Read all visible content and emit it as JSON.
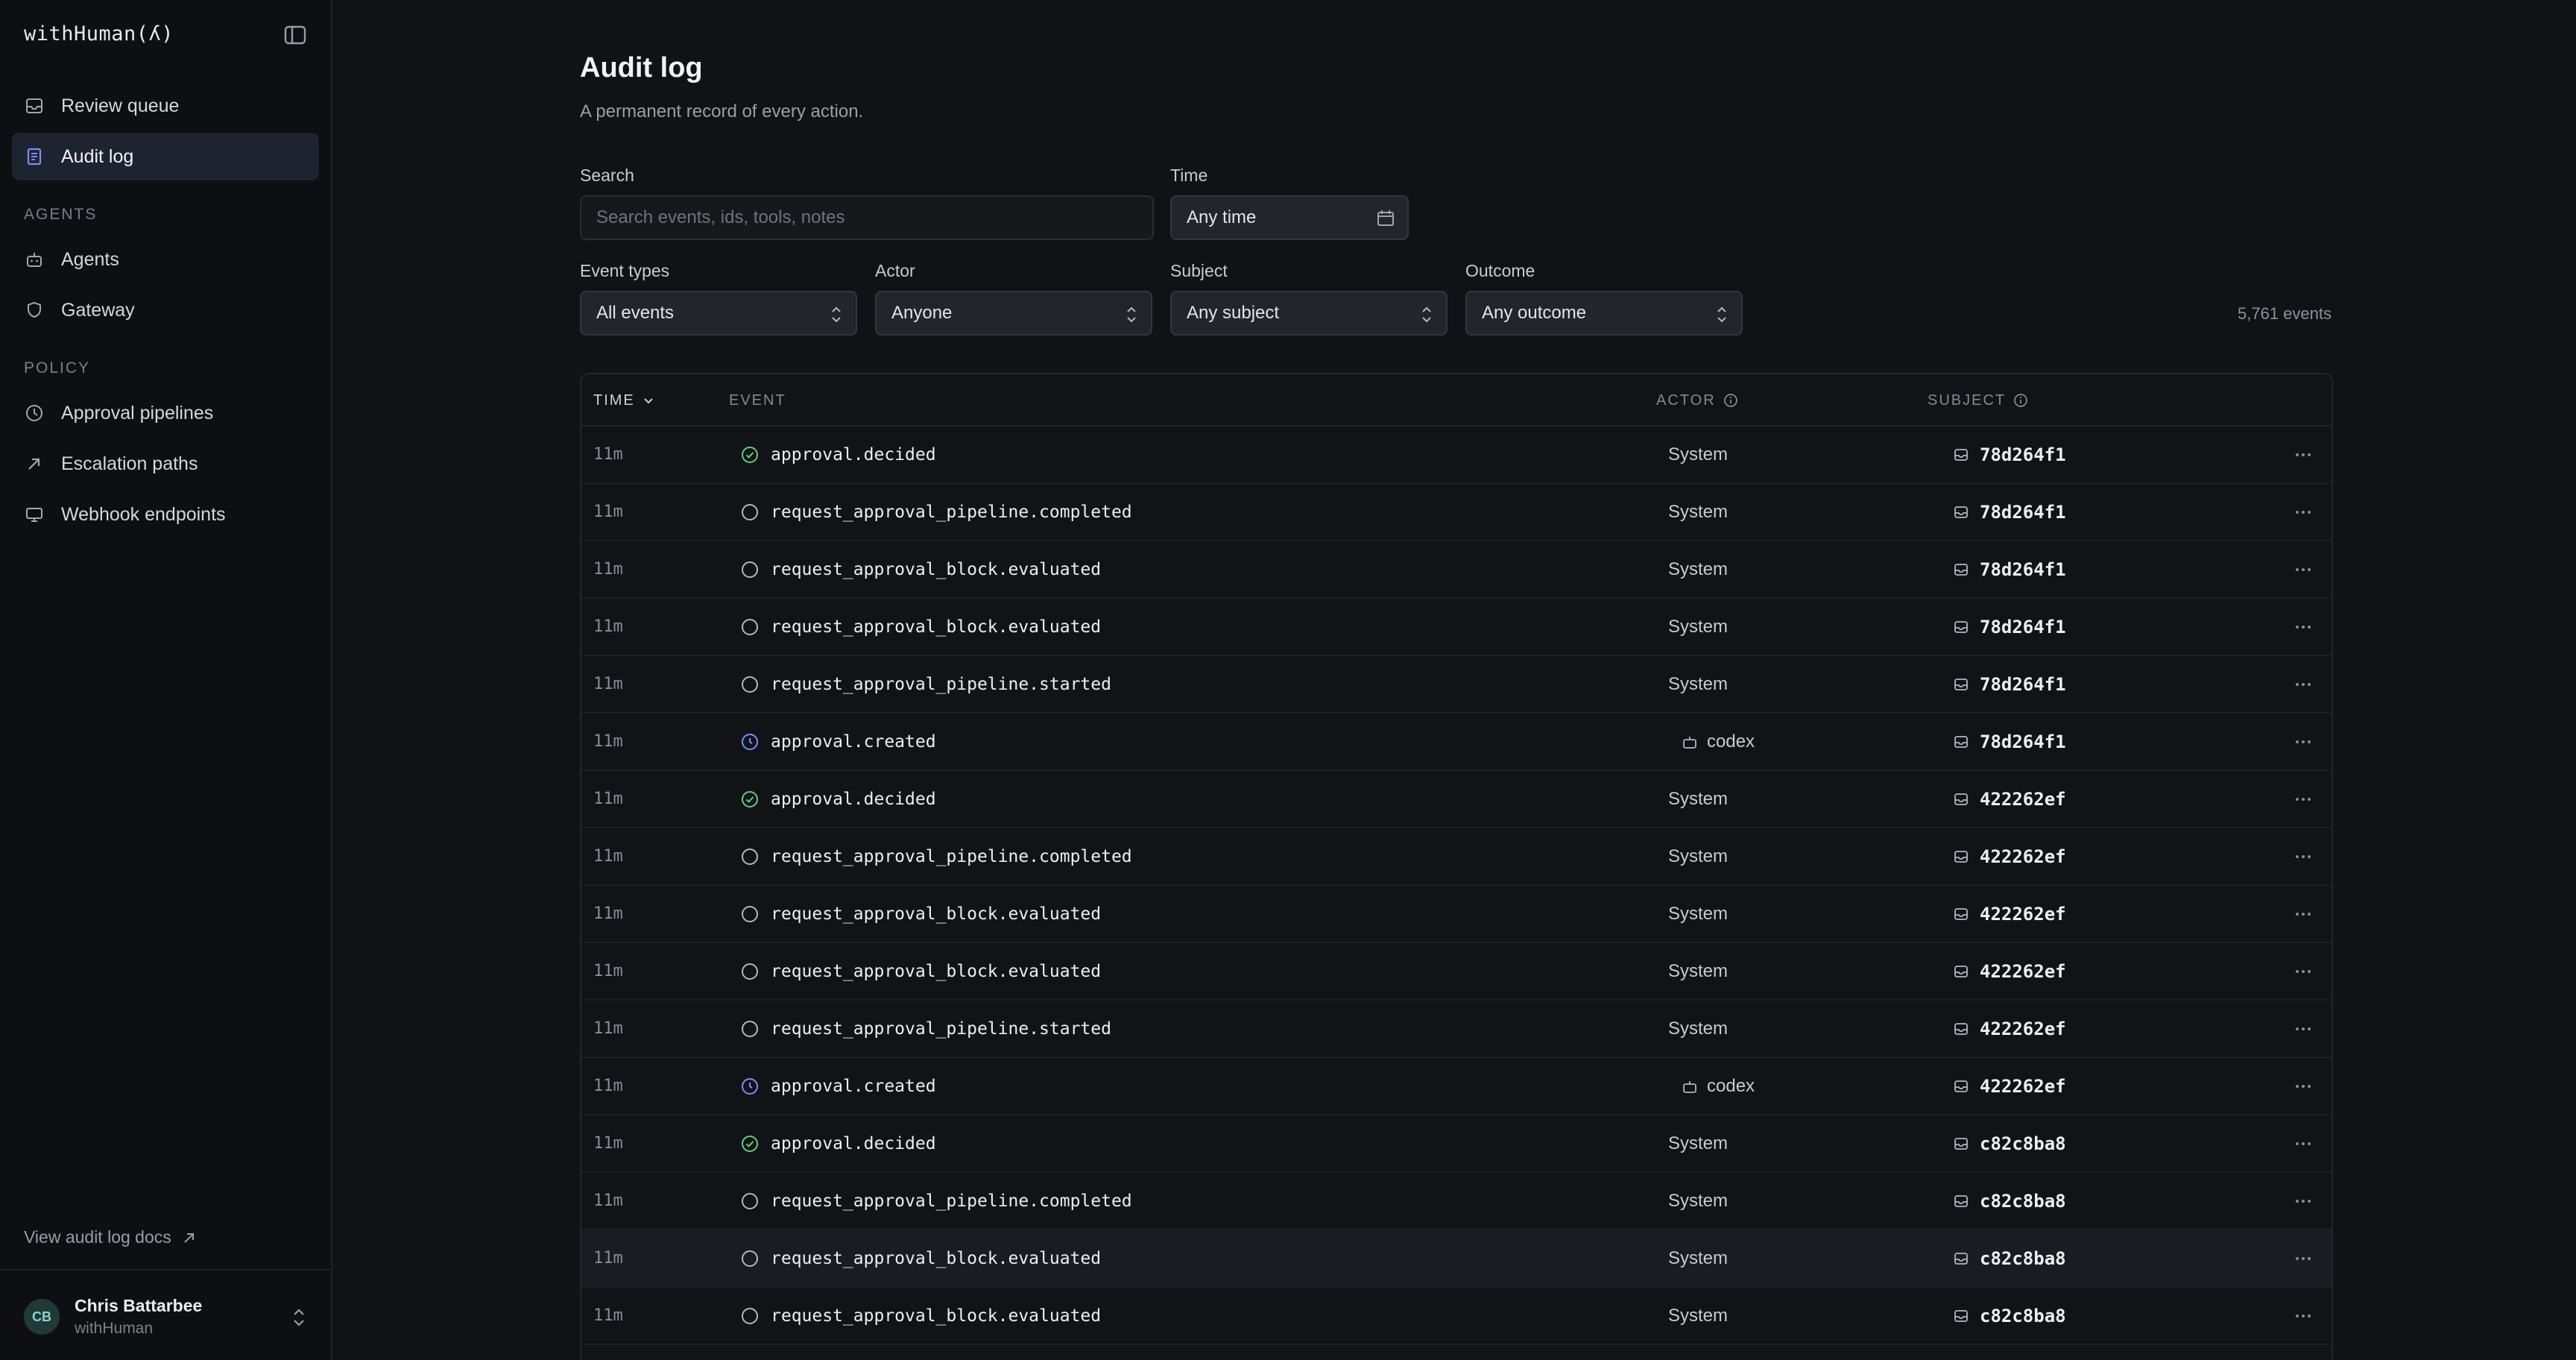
{
  "app": {
    "brand": "withHuman(ʎ)"
  },
  "sidebar": {
    "top_items": [
      {
        "label": "Review queue",
        "icon": "inbox-icon",
        "active": false
      },
      {
        "label": "Audit log",
        "icon": "document-icon",
        "active": true
      }
    ],
    "sections": [
      {
        "title": "AGENTS",
        "items": [
          {
            "label": "Agents",
            "icon": "bot-icon"
          },
          {
            "label": "Gateway",
            "icon": "shield-icon"
          }
        ]
      },
      {
        "title": "POLICY",
        "items": [
          {
            "label": "Approval pipelines",
            "icon": "clock-icon"
          },
          {
            "label": "Escalation paths",
            "icon": "arrow-up-right-icon"
          },
          {
            "label": "Webhook endpoints",
            "icon": "monitor-icon"
          }
        ]
      }
    ],
    "docs_link": "View audit log docs",
    "user": {
      "initials": "CB",
      "name": "Chris Battarbee",
      "org": "withHuman"
    }
  },
  "page": {
    "title": "Audit log",
    "subtitle": "A permanent record of every action."
  },
  "filters": {
    "search": {
      "label": "Search",
      "placeholder": "Search events, ids, tools, notes"
    },
    "time": {
      "label": "Time",
      "value": "Any time"
    },
    "event_types": {
      "label": "Event types",
      "value": "All events"
    },
    "actor": {
      "label": "Actor",
      "value": "Anyone"
    },
    "subject": {
      "label": "Subject",
      "value": "Any subject"
    },
    "outcome": {
      "label": "Outcome",
      "value": "Any outcome"
    },
    "count": "5,761 events"
  },
  "table": {
    "headers": {
      "time": "TIME",
      "event": "EVENT",
      "actor": "ACTOR",
      "subject": "SUBJECT"
    },
    "rows": [
      {
        "time": "11m",
        "event": "approval.decided",
        "status": "success",
        "actor": "System",
        "actor_is_agent": false,
        "subject": "78d264f1"
      },
      {
        "time": "11m",
        "event": "request_approval_pipeline.completed",
        "status": "neutral",
        "actor": "System",
        "actor_is_agent": false,
        "subject": "78d264f1"
      },
      {
        "time": "11m",
        "event": "request_approval_block.evaluated",
        "status": "neutral",
        "actor": "System",
        "actor_is_agent": false,
        "subject": "78d264f1"
      },
      {
        "time": "11m",
        "event": "request_approval_block.evaluated",
        "status": "neutral",
        "actor": "System",
        "actor_is_agent": false,
        "subject": "78d264f1"
      },
      {
        "time": "11m",
        "event": "request_approval_pipeline.started",
        "status": "neutral",
        "actor": "System",
        "actor_is_agent": false,
        "subject": "78d264f1"
      },
      {
        "time": "11m",
        "event": "approval.created",
        "status": "pending",
        "actor": "codex",
        "actor_is_agent": true,
        "subject": "78d264f1"
      },
      {
        "time": "11m",
        "event": "approval.decided",
        "status": "success",
        "actor": "System",
        "actor_is_agent": false,
        "subject": "422262ef"
      },
      {
        "time": "11m",
        "event": "request_approval_pipeline.completed",
        "status": "neutral",
        "actor": "System",
        "actor_is_agent": false,
        "subject": "422262ef"
      },
      {
        "time": "11m",
        "event": "request_approval_block.evaluated",
        "status": "neutral",
        "actor": "System",
        "actor_is_agent": false,
        "subject": "422262ef"
      },
      {
        "time": "11m",
        "event": "request_approval_block.evaluated",
        "status": "neutral",
        "actor": "System",
        "actor_is_agent": false,
        "subject": "422262ef"
      },
      {
        "time": "11m",
        "event": "request_approval_pipeline.started",
        "status": "neutral",
        "actor": "System",
        "actor_is_agent": false,
        "subject": "422262ef"
      },
      {
        "time": "11m",
        "event": "approval.created",
        "status": "pending",
        "actor": "codex",
        "actor_is_agent": true,
        "subject": "422262ef"
      },
      {
        "time": "11m",
        "event": "approval.decided",
        "status": "success",
        "actor": "System",
        "actor_is_agent": false,
        "subject": "c82c8ba8"
      },
      {
        "time": "11m",
        "event": "request_approval_pipeline.completed",
        "status": "neutral",
        "actor": "System",
        "actor_is_agent": false,
        "subject": "c82c8ba8"
      },
      {
        "time": "11m",
        "event": "request_approval_block.evaluated",
        "status": "neutral",
        "actor": "System",
        "actor_is_agent": false,
        "subject": "c82c8ba8",
        "hover": true
      },
      {
        "time": "11m",
        "event": "request_approval_block.evaluated",
        "status": "neutral",
        "actor": "System",
        "actor_is_agent": false,
        "subject": "c82c8ba8"
      }
    ]
  },
  "colors": {
    "success": "#5fcf7d",
    "pending": "#7b8cff",
    "neutral": "#b4b7bf",
    "active_nav": "#1e2330"
  }
}
